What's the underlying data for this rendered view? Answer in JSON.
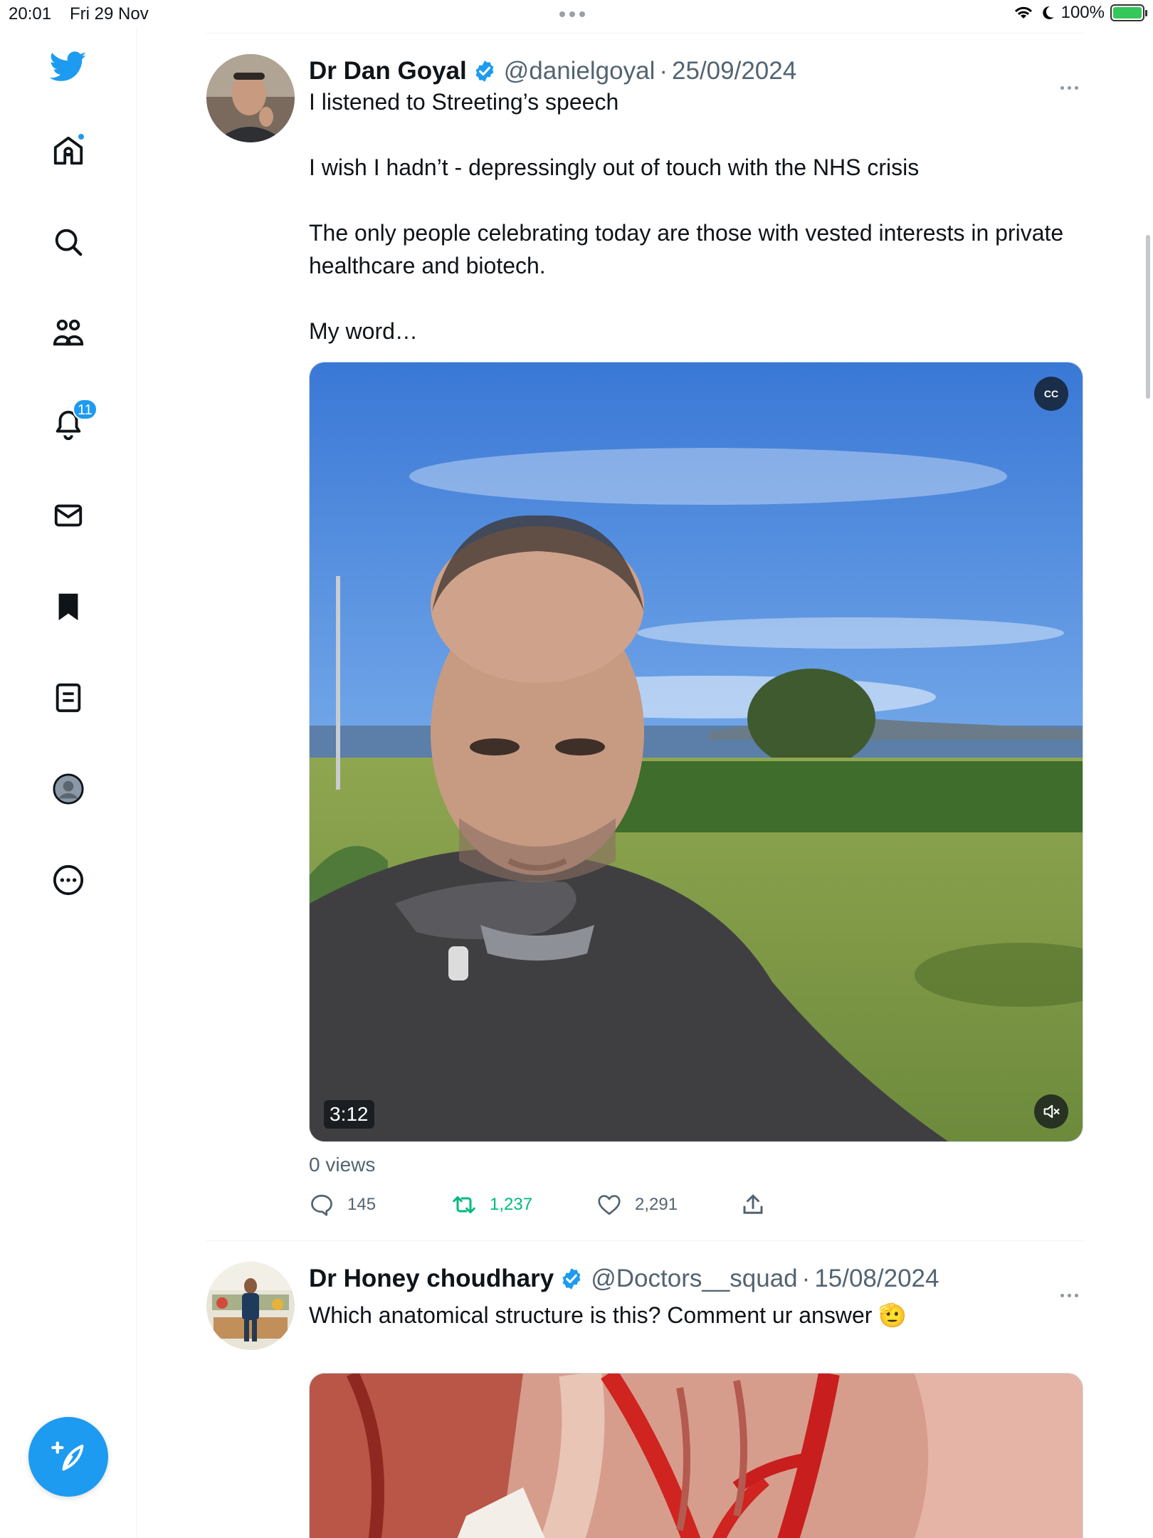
{
  "status_bar": {
    "time": "20:01",
    "date": "Fri 29 Nov",
    "battery": "100%"
  },
  "sidebar": {
    "items": [
      {
        "name": "home",
        "icon": "home-icon"
      },
      {
        "name": "explore",
        "icon": "search-icon"
      },
      {
        "name": "communities",
        "icon": "people-icon"
      },
      {
        "name": "notifications",
        "icon": "bell-icon",
        "badge": "11"
      },
      {
        "name": "messages",
        "icon": "mail-icon"
      },
      {
        "name": "bookmarks",
        "icon": "bookmark-icon"
      },
      {
        "name": "lists",
        "icon": "list-icon"
      },
      {
        "name": "profile",
        "icon": "profile-icon"
      },
      {
        "name": "more",
        "icon": "more-circle-icon"
      }
    ]
  },
  "colors": {
    "accent": "#1d9bf0",
    "retweet": "#00ba7c",
    "secondary_text": "#536471",
    "text": "#0f1419"
  },
  "tweets": [
    {
      "author": "Dr Dan Goyal",
      "handle": "@danielgoyal",
      "date": "25/09/2024",
      "text": {
        "line1": "I listened to Streeting’s speech",
        "line2": "I wish I hadn’t - depressingly out of touch with the NHS crisis",
        "line3": "The only people celebrating today are those with vested interests in private healthcare and biotech.",
        "line4": "My word…"
      },
      "media": {
        "duration": "3:12",
        "cc_label": "CC"
      },
      "views": "0 views",
      "replies": "145",
      "retweets": "1,237",
      "likes": "2,291"
    },
    {
      "author": "Dr Honey choudhary",
      "handle": "@Doctors__squad",
      "date": "15/08/2024",
      "text": "Which anatomical structure is this? Comment ur answer 🫡"
    }
  ]
}
